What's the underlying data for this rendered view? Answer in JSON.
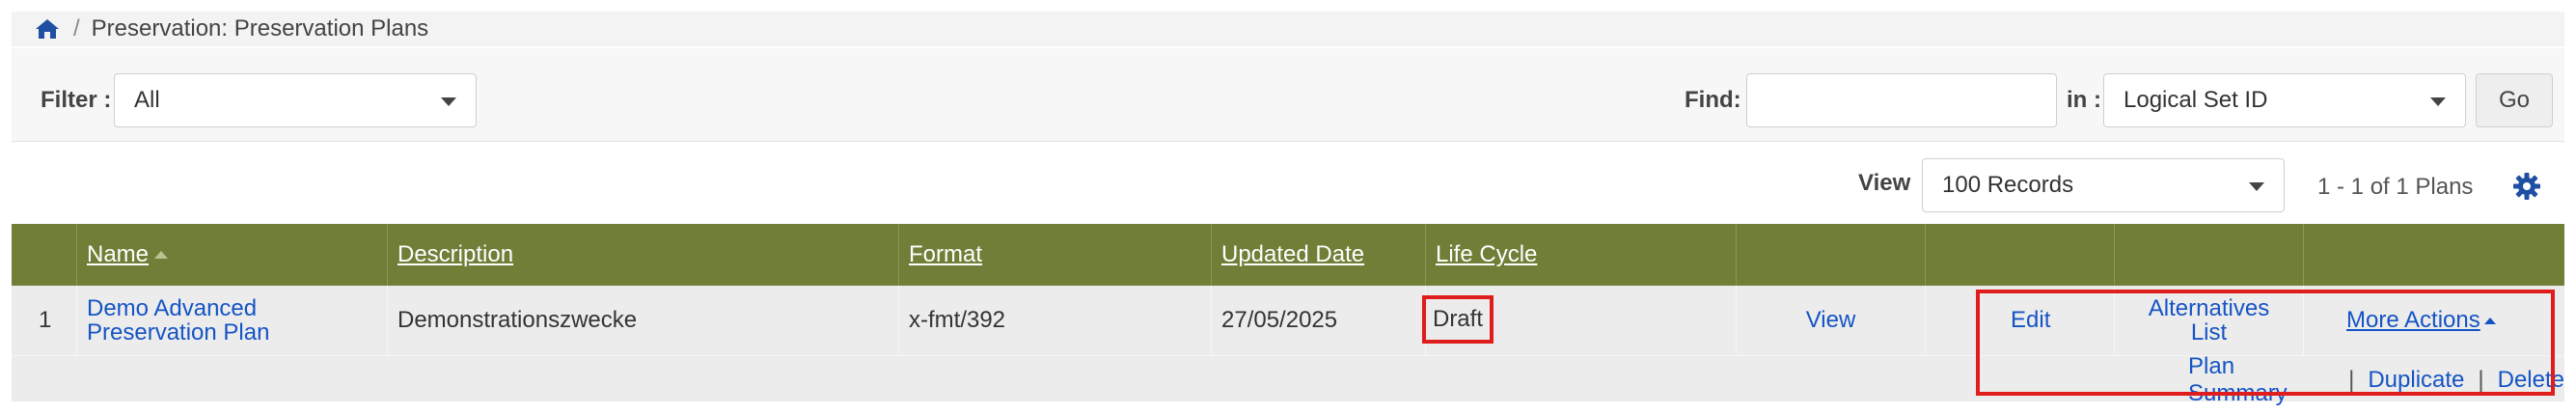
{
  "breadcrumb": {
    "separator": "/",
    "title": "Preservation: Preservation Plans"
  },
  "filter": {
    "label": "Filter :",
    "value": "All"
  },
  "find": {
    "label": "Find:",
    "value": "",
    "in_label": "in :",
    "in_value": "Logical Set ID",
    "go_label": "Go"
  },
  "view": {
    "label": "View",
    "value": "100 Records",
    "count": "1 - 1 of 1 Plans"
  },
  "table": {
    "headers": {
      "name": "Name",
      "description": "Description",
      "format": "Format",
      "updated": "Updated Date",
      "lifecycle": "Life Cycle"
    },
    "rows": [
      {
        "index": "1",
        "name_line1": "Demo Advanced",
        "name_line2": "Preservation Plan",
        "description": "Demonstrationszwecke",
        "format": "x-fmt/392",
        "updated": "27/05/2025",
        "lifecycle": "Draft",
        "view": "View",
        "edit": "Edit",
        "alt_line1": "Alternatives",
        "alt_line2": "List",
        "more_actions": "More Actions",
        "plan_summary": "Plan Summary",
        "duplicate": "Duplicate",
        "delete": "Delete"
      }
    ]
  },
  "colors": {
    "header_bg": "#6f7f38",
    "link": "#1554c5",
    "highlight": "#e01d1d",
    "icon": "#1f4fa3"
  }
}
